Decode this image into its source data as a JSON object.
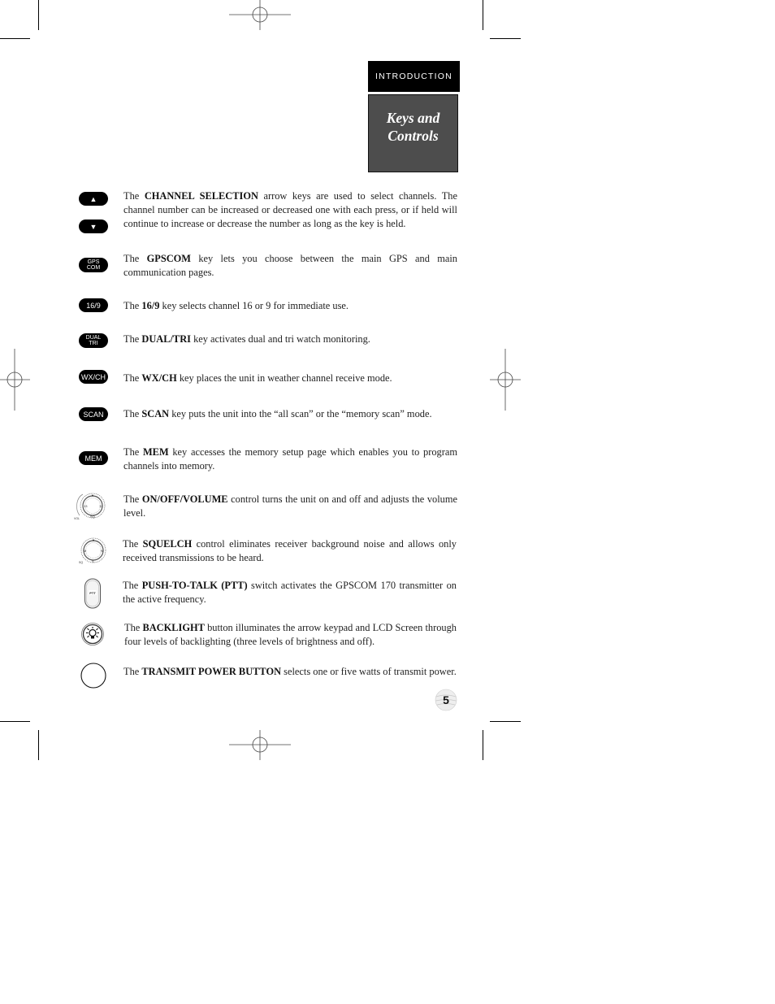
{
  "header": {
    "section_tab": "INTRODUCTION",
    "title_line1": "Keys and",
    "title_line2": "Controls"
  },
  "items": [
    {
      "icon": "arrow-keys-icon",
      "keys": [
        "▲",
        "▼"
      ],
      "prefix": "The ",
      "bold": "CHANNEL SELECTION",
      "text": " arrow keys are used to select channels. The channel number can be increased or decreased one with each press, or if held will continue to increase or decrease the number as long as the key is held."
    },
    {
      "icon": "gpscom-key-icon",
      "keys": [
        "GPS",
        "COM"
      ],
      "prefix": "The ",
      "bold": "GPSCOM",
      "text": " key lets you choose between the main GPS and main communication pages."
    },
    {
      "icon": "16-9-key-icon",
      "keys": [
        "16/9"
      ],
      "prefix": "The ",
      "bold": "16/9",
      "text": " key selects channel 16 or 9 for immediate use."
    },
    {
      "icon": "dual-tri-key-icon",
      "keys": [
        "DUAL",
        "TRI"
      ],
      "prefix": "The ",
      "bold": "DUAL/TRI",
      "text": " key activates dual and tri watch monitoring."
    },
    {
      "icon": "wx-ch-key-icon",
      "keys": [
        "WX/CH"
      ],
      "prefix": "The ",
      "bold": "WX/CH",
      "text": " key places the unit in weather channel receive mode."
    },
    {
      "icon": "scan-key-icon",
      "keys": [
        "SCAN"
      ],
      "prefix": "The ",
      "bold": "SCAN",
      "text": " key puts the unit into the “all scan” or the “memory scan” mode."
    },
    {
      "icon": "mem-key-icon",
      "keys": [
        "MEM"
      ],
      "prefix": "The ",
      "bold": "MEM",
      "text": " key accesses the memory setup page which enables you to program channels into memory."
    },
    {
      "icon": "volume-knob-icon",
      "prefix": "The ",
      "bold": "ON/OFF/VOLUME",
      "text": " control turns the unit on and off and adjusts the volume level."
    },
    {
      "icon": "squelch-knob-icon",
      "prefix": "The ",
      "bold": "SQUELCH",
      "text": " control eliminates receiver background noise and allows only received transmissions to be heard."
    },
    {
      "icon": "ptt-switch-icon",
      "label": "PTT",
      "prefix": "The ",
      "bold": "PUSH-TO-TALK (PTT)",
      "text": " switch activates the GPSCOM 170 transmitter on the active frequency."
    },
    {
      "icon": "backlight-button-icon",
      "prefix": "The ",
      "bold": "BACKLIGHT",
      "text": " button illuminates the arrow keypad and LCD Screen through four levels of backlighting (three levels of brightness and off)."
    },
    {
      "icon": "transmit-power-button-icon",
      "prefix": "The ",
      "bold": "TRANSMIT POWER BUTTON",
      "text": " selects one or five watts of transmit power."
    }
  ],
  "footer": {
    "page_number": "5"
  }
}
